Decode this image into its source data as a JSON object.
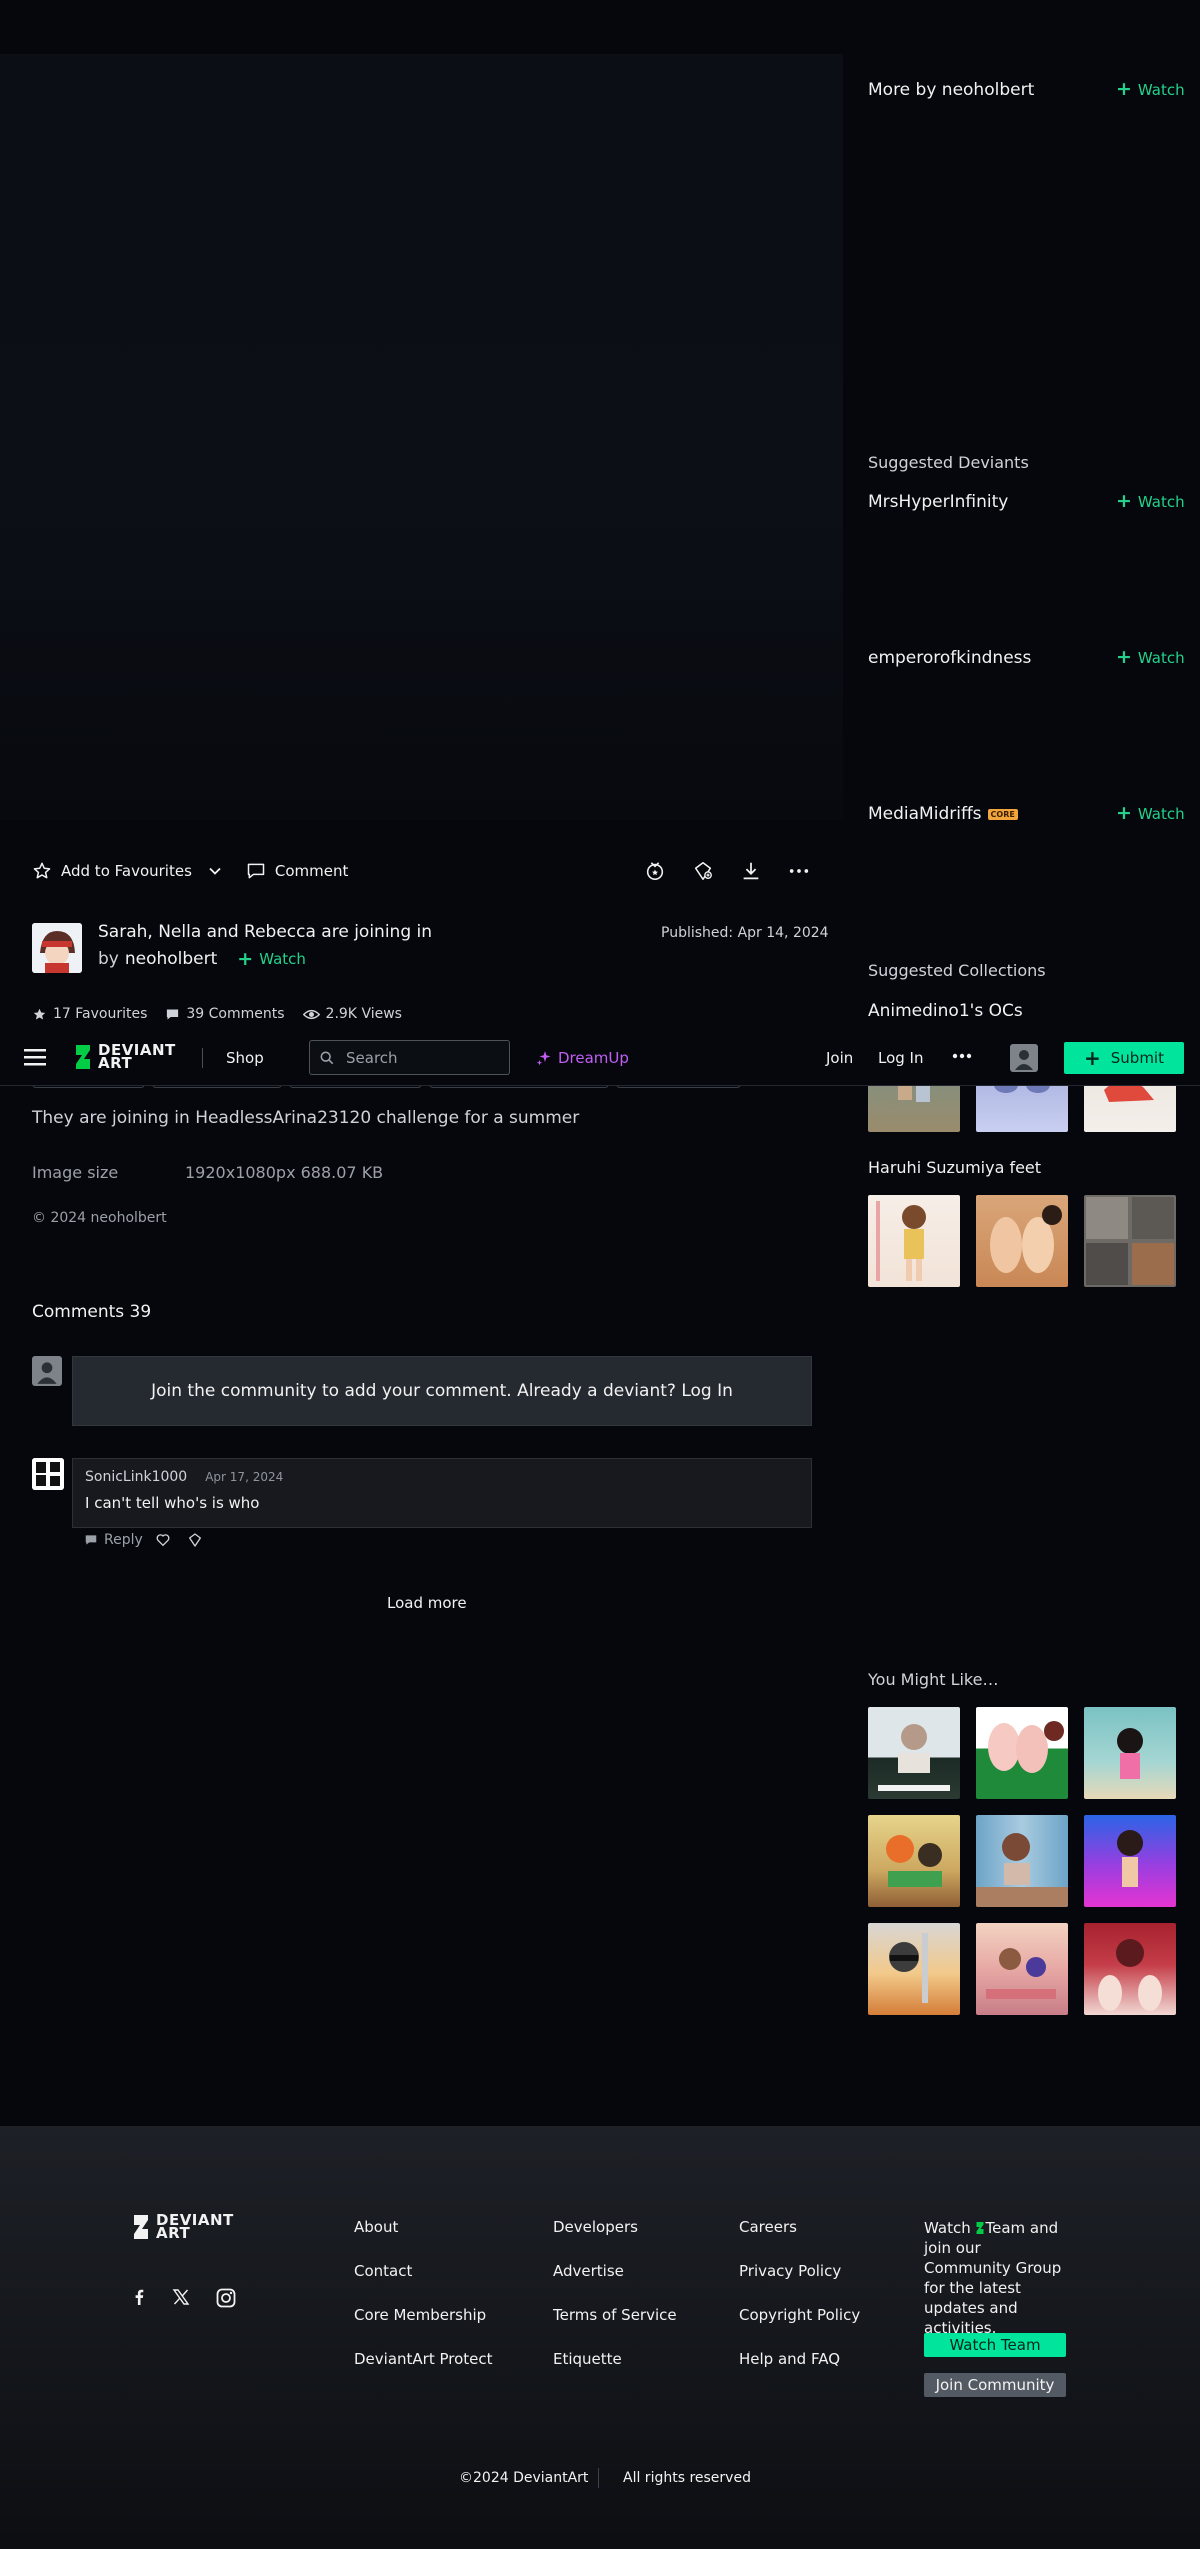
{
  "colors": {
    "accent": "#00e59b",
    "watch": "#23d18b",
    "dreamup": "#c15ff4",
    "core_badge": "#f2a53a"
  },
  "sidebar": {
    "more_by": "More by neoholbert",
    "watch_label": "Watch",
    "suggested_deviants_title": "Suggested Deviants",
    "deviants": [
      {
        "name": "MrsHyperInfinity"
      },
      {
        "name": "emperorofkindness"
      },
      {
        "name": "MediaMidriffs",
        "badge": "CORE"
      }
    ],
    "suggested_collections_title": "Suggested Collections",
    "collections": [
      "Animedino1's OCs",
      "Haruhi Suzumiya feet"
    ],
    "you_might_like_title": "You Might Like…"
  },
  "actions": {
    "add_to_favourites": "Add to Favourites",
    "comment": "Comment"
  },
  "deviation": {
    "title": "Sarah, Nella and Rebecca are joining in",
    "by": "by",
    "author": "neoholbert",
    "watch": "Watch",
    "published": "Published: Apr 14, 2024",
    "favourites": "17 Favourites",
    "comments": "39 Comments",
    "views": "2.9K Views",
    "description": "They are joining in HeadlessArina23120 challenge for a summer",
    "image_size_label": "Image size",
    "image_size_value": "1920x1080px 688.07 KB",
    "copyright": "© 2024 neoholbert"
  },
  "nav": {
    "logo_text": "DEVIANT ART",
    "shop": "Shop",
    "search_placeholder": "Search",
    "dreamup": "DreamUp",
    "join": "Join",
    "login": "Log In",
    "submit": "Submit"
  },
  "comments": {
    "title": "Comments 39",
    "join_prompt": "Join the community to add your comment. Already a deviant? Log In",
    "items": [
      {
        "user": "SonicLink1000",
        "date": "Apr 17, 2024",
        "text": "I can't tell who's is who",
        "reply": "Reply"
      }
    ],
    "load_more": "Load more"
  },
  "footer": {
    "logo_text": "DEVIANT ART",
    "links_col1": [
      "About",
      "Contact",
      "Core Membership",
      "DeviantArt Protect"
    ],
    "links_col2": [
      "Developers",
      "Advertise",
      "Terms of Service",
      "Etiquette"
    ],
    "links_col3": [
      "Careers",
      "Privacy Policy",
      "Copyright Policy",
      "Help and FAQ"
    ],
    "watch_text_a": "Watch",
    "watch_text_b": "Team and join our Community Group for the latest updates and activities.",
    "watch_team": "Watch Team",
    "join_community": "Join Community",
    "copyright": "©2024 DeviantArt",
    "rights": "All rights reserved"
  }
}
